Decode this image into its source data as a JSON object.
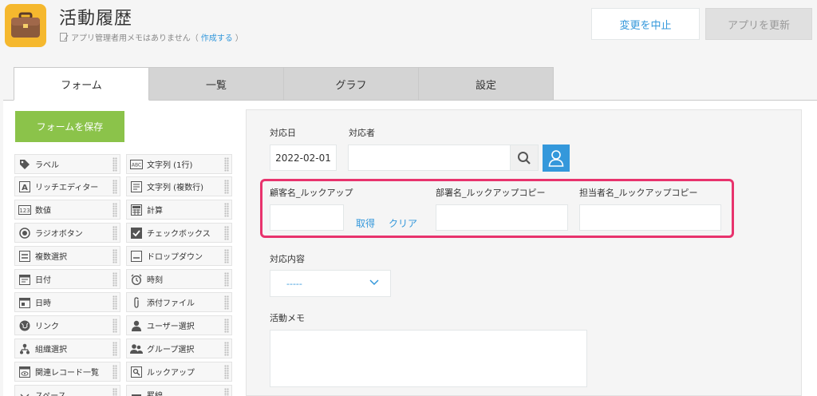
{
  "header": {
    "title": "活動履歴",
    "memo_text": "アプリ管理者用メモはありません（",
    "memo_link": "作成する",
    "memo_close": "）",
    "cancel_label": "変更を中止",
    "update_label": "アプリを更新"
  },
  "tabs": [
    {
      "label": "フォーム",
      "active": true
    },
    {
      "label": "一覧",
      "active": false
    },
    {
      "label": "グラフ",
      "active": false
    },
    {
      "label": "設定",
      "active": false
    }
  ],
  "palette": {
    "save_label": "フォームを保存",
    "items": [
      {
        "label": "ラベル",
        "icon": "tag-icon"
      },
      {
        "label": "文字列 (1行)",
        "icon": "abc-icon"
      },
      {
        "label": "リッチエディター",
        "icon": "rich-text-icon"
      },
      {
        "label": "文字列 (複数行)",
        "icon": "multiline-text-icon"
      },
      {
        "label": "数値",
        "icon": "number-icon"
      },
      {
        "label": "計算",
        "icon": "calculator-icon"
      },
      {
        "label": "ラジオボタン",
        "icon": "radio-icon"
      },
      {
        "label": "チェックボックス",
        "icon": "checkbox-icon"
      },
      {
        "label": "複数選択",
        "icon": "multi-select-icon"
      },
      {
        "label": "ドロップダウン",
        "icon": "dropdown-icon"
      },
      {
        "label": "日付",
        "icon": "date-icon"
      },
      {
        "label": "時刻",
        "icon": "clock-icon"
      },
      {
        "label": "日時",
        "icon": "datetime-icon"
      },
      {
        "label": "添付ファイル",
        "icon": "paperclip-icon"
      },
      {
        "label": "リンク",
        "icon": "globe-icon"
      },
      {
        "label": "ユーザー選択",
        "icon": "user-icon"
      },
      {
        "label": "組織選択",
        "icon": "org-icon"
      },
      {
        "label": "グループ選択",
        "icon": "group-icon"
      },
      {
        "label": "関連レコード一覧",
        "icon": "related-records-icon"
      },
      {
        "label": "ルックアップ",
        "icon": "lookup-icon"
      },
      {
        "label": "スペース",
        "icon": "space-icon"
      },
      {
        "label": "罫線",
        "icon": "line-icon"
      }
    ]
  },
  "form": {
    "date_label": "対応日",
    "date_value": "2022-02-01",
    "assignee_label": "対応者",
    "customer_label": "顧客名_ルックアップ",
    "fetch_label": "取得",
    "clear_label": "クリア",
    "dept_label": "部署名_ルックアップコピー",
    "person_label": "担当者名_ルックアップコピー",
    "content_label": "対応内容",
    "content_value": "-----",
    "memo_label": "活動メモ"
  },
  "colors": {
    "accent": "#3498db",
    "save_green": "#8bc34a",
    "highlight": "#e8336d",
    "app_icon": "#f5b82e"
  }
}
